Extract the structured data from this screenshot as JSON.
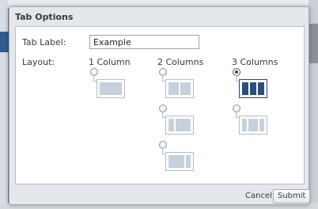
{
  "dialog": {
    "title": "Tab Options"
  },
  "form": {
    "tab_label": {
      "label": "Tab Label:",
      "value": "Example"
    },
    "layout": {
      "label": "Layout:",
      "columns": [
        {
          "heading": "1 Column"
        },
        {
          "heading": "2 Columns"
        },
        {
          "heading": "3 Columns"
        }
      ],
      "options": [
        {
          "id": "1col",
          "panes": [
            1
          ],
          "selected": false
        },
        {
          "id": "2col-equal",
          "panes": [
            1,
            1
          ],
          "selected": false
        },
        {
          "id": "2col-left-narrow",
          "panes": [
            1,
            3
          ],
          "selected": false
        },
        {
          "id": "2col-right-narrow",
          "panes": [
            3,
            1
          ],
          "selected": false
        },
        {
          "id": "3col-equal",
          "panes": [
            1,
            1,
            1
          ],
          "selected": true
        },
        {
          "id": "3col-wide-center",
          "panes": [
            1,
            2,
            1
          ],
          "selected": false
        }
      ]
    }
  },
  "footer": {
    "cancel_label": "Cancel",
    "submit_label": "Submit"
  },
  "colors": {
    "selected_pane": "#2c4e7c",
    "unselected_pane": "#c5d1dc",
    "dialog_bg": "#e4e7eb"
  }
}
